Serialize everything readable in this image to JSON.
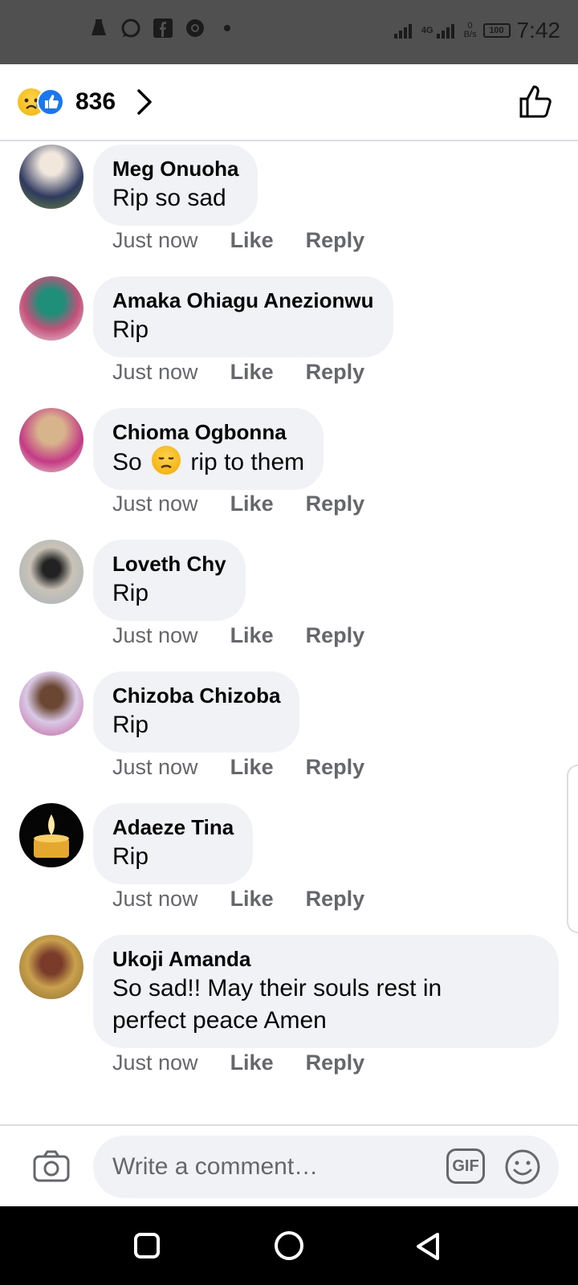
{
  "status_bar": {
    "time": "7:42",
    "network": "4G",
    "speed_value": "0",
    "speed_unit": "B/s",
    "battery": "100",
    "notification_icons": [
      "person-icon",
      "whatsapp-icon",
      "facebook-icon",
      "chrome-icon",
      "dot-icon"
    ]
  },
  "reactions": {
    "icons": [
      "sad-reaction-icon",
      "like-reaction-icon"
    ],
    "count": "836"
  },
  "comments": [
    {
      "author": "Meg Onuoha",
      "text": "Rip so sad",
      "time": "Just now",
      "like": "Like",
      "reply": "Reply"
    },
    {
      "author": "Amaka Ohiagu Anezionwu",
      "text": "Rip",
      "time": "Just now",
      "like": "Like",
      "reply": "Reply"
    },
    {
      "author": "Chioma Ogbonna",
      "text_before": "So",
      "text_after": "rip to them",
      "time": "Just now",
      "like": "Like",
      "reply": "Reply"
    },
    {
      "author": "Loveth Chy",
      "text": "Rip",
      "time": "Just now",
      "like": "Like",
      "reply": "Reply"
    },
    {
      "author": "Chizoba Chizoba",
      "text": "Rip",
      "time": "Just now",
      "like": "Like",
      "reply": "Reply"
    },
    {
      "author": "Adaeze Tina",
      "text": "Rip",
      "time": "Just now",
      "like": "Like",
      "reply": "Reply"
    },
    {
      "author": "Ukoji Amanda",
      "text_line1": "So sad!!  May their souls rest in",
      "text_line2": "perfect peace Amen",
      "time": "Just now",
      "like": "Like",
      "reply": "Reply"
    }
  ],
  "composer": {
    "placeholder": "Write a comment…",
    "gif_label": "GIF"
  },
  "colors": {
    "bubble": "#f0f2f5",
    "meta_text": "#65676b",
    "like_blue": "#1877f2",
    "status_bar": "#505050"
  }
}
